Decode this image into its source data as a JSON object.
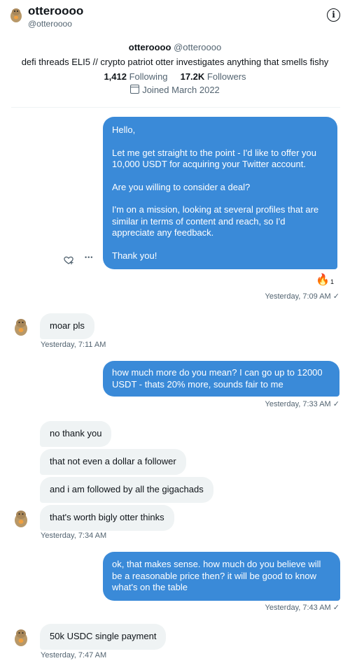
{
  "header": {
    "name": "otteroooo",
    "handle": "@otteroooo"
  },
  "profile": {
    "name": "otteroooo",
    "handle": "@otteroooo",
    "bio": "defi threads ELI5 // crypto patriot otter investigates anything that smells fishy",
    "following_count": "1,412",
    "following_label": "Following",
    "followers_count": "17.2K",
    "followers_label": "Followers",
    "joined": "Joined March 2022"
  },
  "messages": [
    {
      "paragraphs": [
        "Hello,",
        "Let me get straight to the point - I'd like to offer you 10,000 USDT for acquiring your Twitter account.",
        "Are you willing to consider a deal?",
        "I'm on a mission, looking at several profiles that are similar in terms of content and reach, so I'd appreciate any feedback.",
        "Thank you!"
      ],
      "reaction_count": "1",
      "timestamp": "Yesterday, 7:09 AM"
    },
    {
      "text": "moar pls",
      "timestamp": "Yesterday, 7:11 AM"
    },
    {
      "text": "how much more do you mean? I can go up to 12000 USDT - thats 20% more, sounds fair to me",
      "timestamp": "Yesterday, 7:33 AM"
    },
    {
      "text": "no thank you"
    },
    {
      "text": "that not even a dollar a follower"
    },
    {
      "text": "and i am followed by all the gigachads"
    },
    {
      "text": "that's worth bigly otter thinks",
      "timestamp": "Yesterday, 7:34 AM"
    },
    {
      "text": "ok, that makes sense. how much do you believe will be a reasonable price then? it will be good to know what's on the table",
      "timestamp": "Yesterday, 7:43 AM"
    },
    {
      "text": "50k USDC single payment",
      "timestamp": "Yesterday, 7:47 AM"
    }
  ],
  "icons": {
    "sent_check": "✓",
    "info": "i",
    "more": "•••",
    "reaction_emoji": "🔥"
  },
  "colors": {
    "outgoing_bubble": "#3a8ad8",
    "incoming_bubble": "#eff3f4",
    "muted_text": "#536471"
  }
}
